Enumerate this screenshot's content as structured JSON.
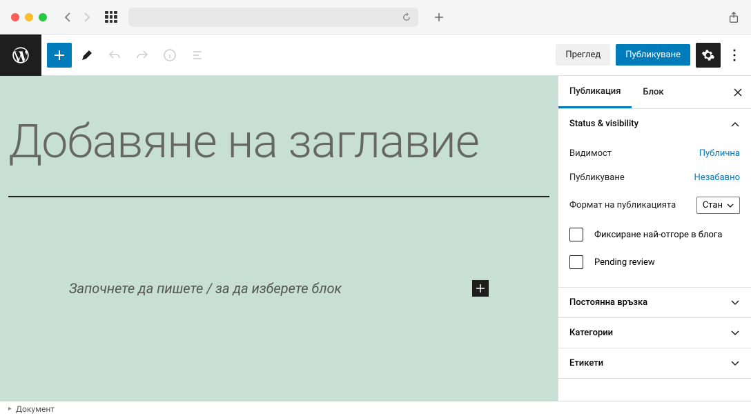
{
  "toolbar": {
    "preview": "Преглед",
    "publish": "Публикуване"
  },
  "sidebar": {
    "tabs": {
      "post": "Публикация",
      "block": "Блок"
    },
    "panels": {
      "status": {
        "title": "Status & visibility",
        "visibility_label": "Видимост",
        "visibility_value": "Публична",
        "publish_label": "Публикуване",
        "publish_value": "Незабавно",
        "format_label": "Формат на публикацията",
        "format_value": "Стан",
        "sticky": "Фиксиране най-отгоре в блога",
        "pending": "Pending review"
      },
      "permalink": "Постоянна връзка",
      "categories": "Категории",
      "tags": "Етикети"
    }
  },
  "editor": {
    "title_placeholder": "Добавяне на заглавие",
    "block_prompt": "Започнете да пишете / за да изберете блок"
  },
  "footer": {
    "breadcrumb": "Документ"
  }
}
